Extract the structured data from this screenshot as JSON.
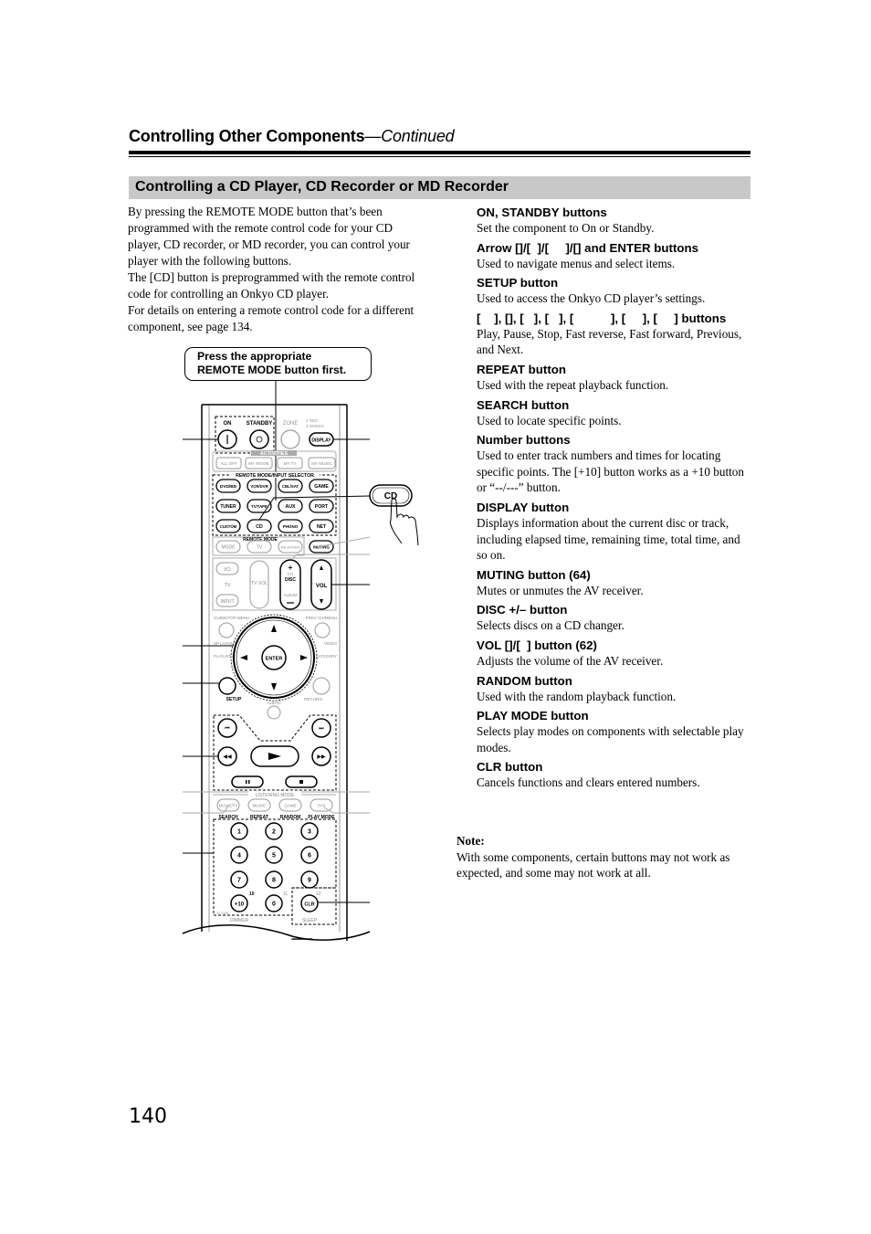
{
  "header": {
    "title": "Controlling Other Components",
    "continued": "—Continued"
  },
  "section": {
    "title": "Controlling a CD Player, CD Recorder or MD Recorder"
  },
  "intro": [
    "By pressing the REMOTE MODE button that’s been programmed with the remote control code for your CD player, CD recorder, or MD recorder, you can control your player with the following buttons.",
    "The [CD] button is preprogrammed with the remote control code for controlling an Onkyo CD player.",
    "For details on entering a remote control code for a different component, see page 134."
  ],
  "callout": {
    "line1": "Press the appropriate",
    "line2": "REMOTE MODE button first."
  },
  "cd_button_label": "CD",
  "buttons": [
    {
      "heading": "ON, STANDBY buttons",
      "desc": "Set the component to On or Standby."
    },
    {
      "heading": "Arrow []/[  ]/[     ]/[] and ENTER buttons",
      "desc": "Used to navigate menus and select items."
    },
    {
      "heading": "SETUP button",
      "desc": "Used to access the Onkyo CD player’s settings."
    },
    {
      "heading": "[    ], [], [   ], [   ], [           ], [     ], [     ] buttons",
      "desc": "Play, Pause, Stop, Fast reverse, Fast forward, Previous, and Next."
    },
    {
      "heading": "REPEAT button",
      "desc": "Used with the repeat playback function."
    },
    {
      "heading": "SEARCH button",
      "desc": "Used to locate specific points."
    },
    {
      "heading": "Number buttons",
      "desc": "Used to enter track numbers and times for locating specific points. The [+10] button works as a +10 button or “--/---” button."
    },
    {
      "heading": "DISPLAY button",
      "desc": "Displays information about the current disc or track, including elapsed time, remaining time, total time, and so on."
    },
    {
      "heading": "MUTING button (64)",
      "desc": "Mutes or unmutes the AV receiver."
    },
    {
      "heading": "DISC +/– button",
      "desc": "Selects discs on a CD changer."
    },
    {
      "heading": "VOL []/[  ] button (62)",
      "desc": "Adjusts the volume of the AV receiver."
    },
    {
      "heading": "RANDOM button",
      "desc": "Used with the random playback function."
    },
    {
      "heading": "PLAY MODE button",
      "desc": "Selects play modes on components with selectable play modes."
    },
    {
      "heading": "CLR button",
      "desc": "Cancels functions and clears entered numbers."
    }
  ],
  "note": {
    "heading": "Note:",
    "text": "With some components, certain buttons may not work as expected, and some may not work at all."
  },
  "page_number": "140",
  "remote": {
    "on": "ON",
    "standby": "STANDBY",
    "zone": "ZONE",
    "zone_sub1": "2 RED",
    "zone_sub2": "3 GREEN",
    "display": "DISPLAY",
    "activities": "ACTIVITIES",
    "activity_buttons": [
      "ALL OFF",
      "MY MOVIE",
      "MY TV",
      "MY MUSIC"
    ],
    "remote_mode_input": "REMOTE MODE/INPUT SELECTOR",
    "input_row1": [
      "DVD/BD",
      "VCR/DVR",
      "CBL/SAT",
      "GAME"
    ],
    "input_row2": [
      "TUNER",
      "TV/TAPE",
      "AUX",
      "PORT"
    ],
    "input_row3": [
      "CUSTOM",
      "CD",
      "PHONO",
      "NET"
    ],
    "remote_mode": "REMOTE MODE",
    "mode_row": [
      "MODE",
      "TV",
      "RECEIVER",
      "MUTING"
    ],
    "tv_power": "I/⏻",
    "tv": "TV",
    "input": "INPUT",
    "tv_vol": "TV VOL",
    "ch": "CH",
    "disc": "DISC",
    "album": "ALBUM",
    "vol": "VOL",
    "guide": "GUIDE/TOP MENU",
    "prev_ch": "PREV CH/MENU",
    "sp_layout": "SP LAYOUT",
    "video": "VIDEO",
    "playlist_l": "PLAYLIST /CATEGORY",
    "playlist_r": "PLAYLIST CATEGORY",
    "enter": "ENTER",
    "setup": "SETUP",
    "return": "RETURN",
    "audio": "AUDIO",
    "listening_mode": "LISTENING MODE",
    "lm_buttons": [
      "MOVIE/TV",
      "MUSIC",
      "GAME",
      "THX"
    ],
    "lm_labels": [
      "SEARCH",
      "REPEAT",
      "RANDOM",
      "PLAY MODE"
    ],
    "numbers": [
      "1",
      "2",
      "3",
      "4",
      "5",
      "6",
      "7",
      "8",
      "9",
      "+10",
      "0",
      "CLR"
    ],
    "num_10": "10",
    "num_11": "11",
    "num_12": "12",
    "dtun": "D.TUN",
    "dimmer": "DIMMER",
    "sleep": "SLEEP"
  }
}
